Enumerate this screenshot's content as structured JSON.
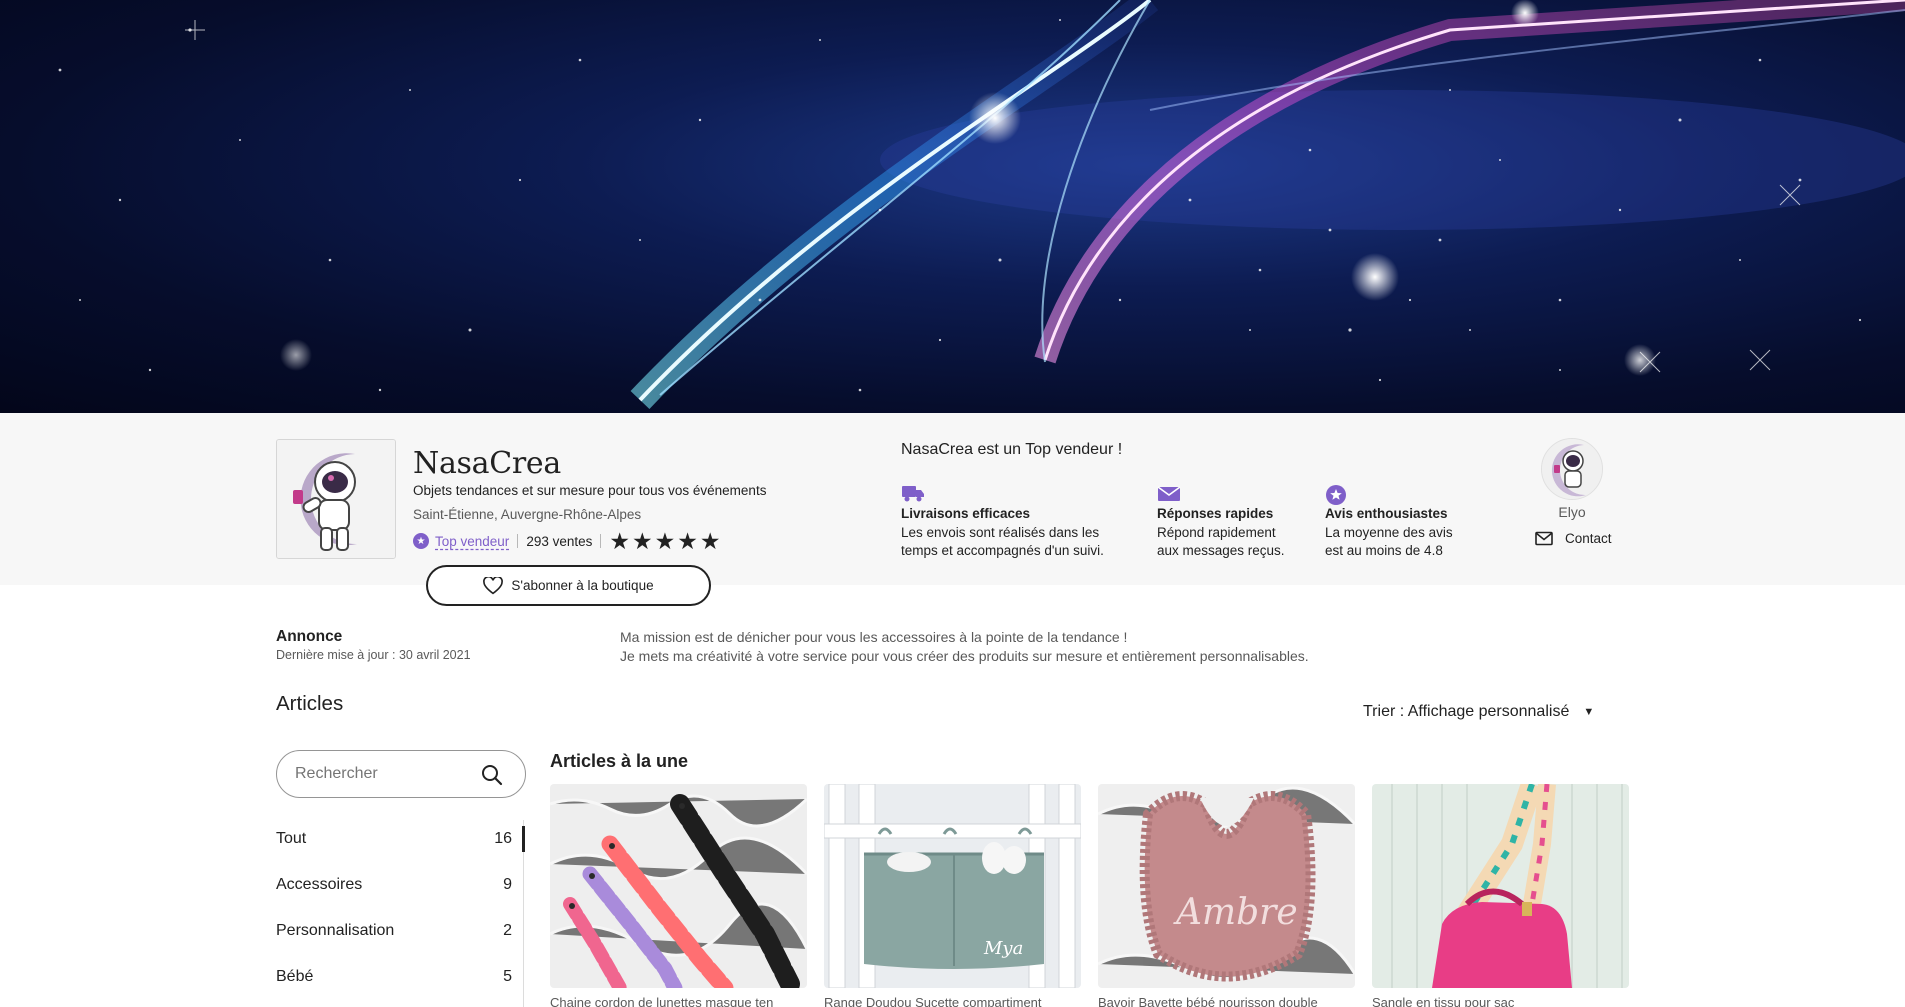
{
  "shop": {
    "name": "NasaCrea",
    "tagline": "Objets tendances et sur mesure pour tous vos événements",
    "location": "Saint-Étienne, Auvergne-Rhône-Alpes",
    "badge_label": "Top vendeur",
    "sales": "293 ventes",
    "rating_stars": 5,
    "follow_label": "S'abonner à la boutique"
  },
  "top_seller": {
    "title": "NasaCrea est un Top vendeur !",
    "features": [
      {
        "icon": "truck-icon",
        "title": "Livraisons efficaces",
        "text_line1": "Les envois sont réalisés dans les",
        "text_line2": "temps et accompagnés d'un suivi."
      },
      {
        "icon": "envelope-icon",
        "title": "Réponses rapides",
        "text_line1": "Répond rapidement",
        "text_line2": "aux messages reçus."
      },
      {
        "icon": "star-badge-icon",
        "title": "Avis enthousiastes",
        "text_line1": "La moyenne des avis",
        "text_line2": "est au moins de 4.8"
      }
    ]
  },
  "owner": {
    "name": "Elyo",
    "contact_label": "Contact"
  },
  "announcement": {
    "label": "Annonce",
    "updated": "Dernière mise à jour : 30 avril 2021",
    "line1": "Ma mission est de dénicher pour vous les accessoires à la pointe de la tendance !",
    "line2": "Je mets ma créativité à votre service pour vous créer des produits sur mesure et entièrement personnalisables."
  },
  "articles": {
    "title": "Articles",
    "sort_label": "Trier : Affichage personnalisé",
    "search_placeholder": "Rechercher",
    "featured_title": "Articles à la une",
    "categories": [
      {
        "label": "Tout",
        "count": "16"
      },
      {
        "label": "Accessoires",
        "count": "9"
      },
      {
        "label": "Personnalisation",
        "count": "2"
      },
      {
        "label": "Bébé",
        "count": "5"
      }
    ],
    "products": [
      {
        "title": "Chaine cordon de lunettes masque ten"
      },
      {
        "title": "Range Doudou Sucette compartiment"
      },
      {
        "title": "Bavoir Bavette bébé nourisson double"
      },
      {
        "title": "Sangle en tissu pour sac"
      }
    ],
    "product_image_text": {
      "mya": "Mya",
      "ambre": "Ambre"
    }
  },
  "colors": {
    "accent_purple": "#7f5fc9",
    "text_primary": "#222222",
    "text_secondary": "#595959",
    "header_bg": "#f7f7f7"
  }
}
